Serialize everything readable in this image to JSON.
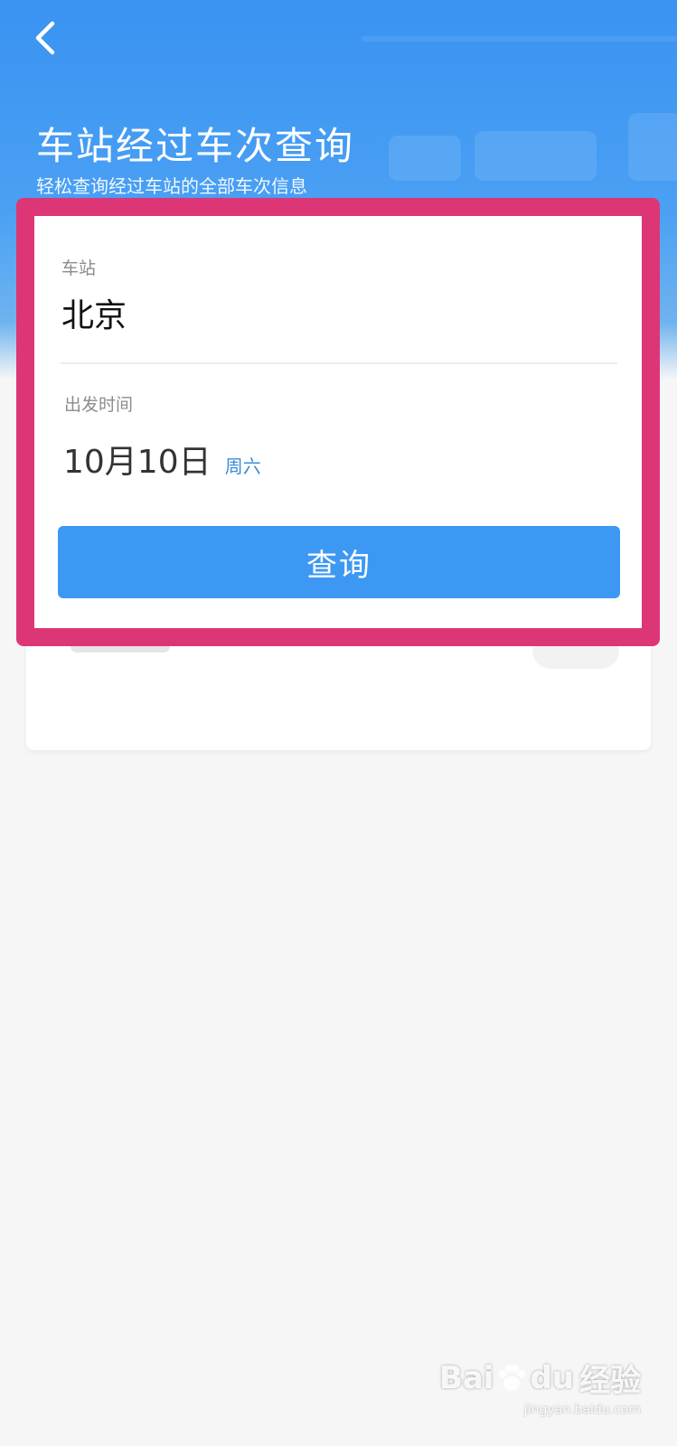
{
  "header": {
    "title": "车站经过车次查询",
    "subtitle": "轻松查询经过车站的全部车次信息"
  },
  "form": {
    "station_label": "车站",
    "station_value": "北京",
    "date_label": "出发时间",
    "date_value": "10月10日",
    "weekday": "周六",
    "query_button": "查询"
  },
  "watermark": {
    "brand": "Bai",
    "brand_tail": "du",
    "brand_cn": "经验",
    "url": "jingyan.baidu.com"
  },
  "colors": {
    "header_blue": "#3a93f2",
    "button_blue": "#3d98f4",
    "weekday_blue": "#3a8fd9",
    "highlight_pink": "#dd3676"
  },
  "icons": {
    "back": "chevron-left-icon",
    "watermark": "paw-icon"
  }
}
